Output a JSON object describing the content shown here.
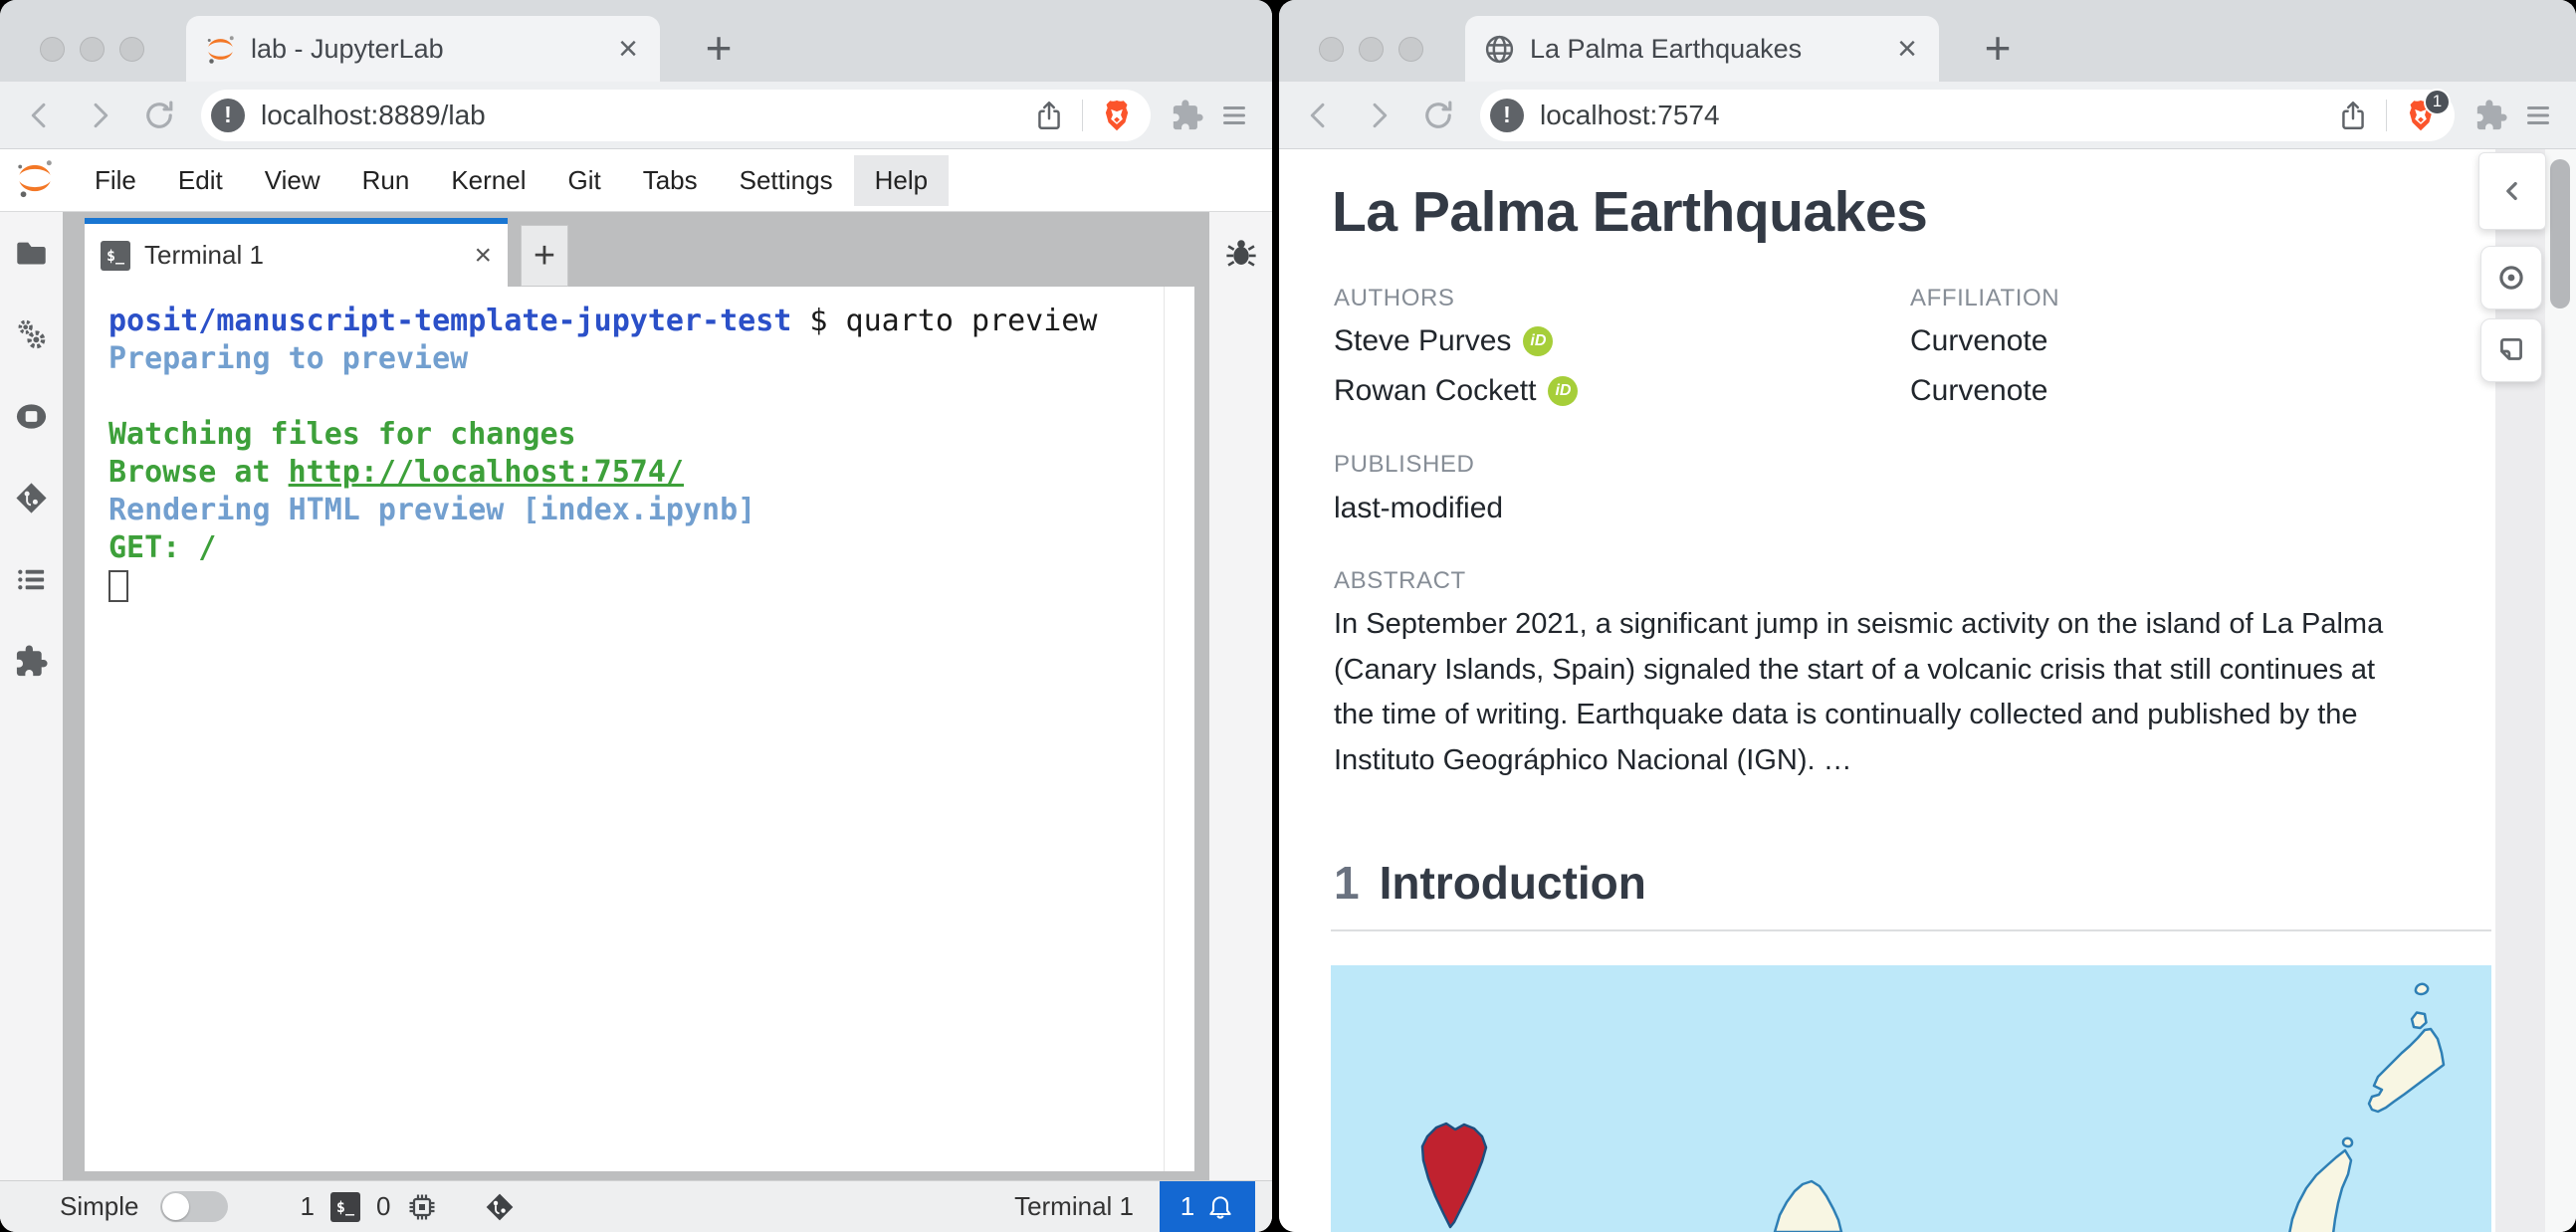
{
  "colors": {
    "accent_blue": "#1976d2",
    "notification_blue": "#1468d2",
    "orcid_green": "#a6ce39",
    "brave_orange": "#fb542b",
    "jupyter_orange": "#f37726",
    "terminal_blue": "#2b50c8",
    "terminal_lightblue": "#729fcf",
    "terminal_green": "#3da03a",
    "map_sea": "#bde8f9",
    "map_land": "#f8f6e3",
    "map_outline": "#2e7fb5",
    "map_highlight": "#c0222f"
  },
  "glyphs": {
    "close": "×",
    "new_tab": "+",
    "add_tab": "+",
    "terminal": "$_",
    "orcid": "iD",
    "info": "!"
  },
  "left_window": {
    "tab_title": "lab - JupyterLab",
    "url": "localhost:8889/lab",
    "menu": [
      "File",
      "Edit",
      "View",
      "Run",
      "Kernel",
      "Git",
      "Tabs",
      "Settings",
      "Help"
    ],
    "dock_tab": "Terminal 1",
    "terminal": {
      "lines": [
        {
          "segments": [
            {
              "text": "posit/manuscript-template-jupyter-test",
              "style": "path"
            },
            {
              "text": " $ quarto preview",
              "style": "plain"
            }
          ]
        },
        {
          "segments": [
            {
              "text": "Preparing to preview",
              "style": "info"
            }
          ]
        },
        {
          "segments": []
        },
        {
          "segments": [
            {
              "text": "Watching files for changes",
              "style": "ok"
            }
          ]
        },
        {
          "segments": [
            {
              "text": "Browse at ",
              "style": "ok"
            },
            {
              "text": "http://localhost:7574/",
              "style": "ok-link"
            }
          ]
        },
        {
          "segments": [
            {
              "text": "Rendering HTML preview [index.ipynb]",
              "style": "info"
            }
          ]
        },
        {
          "segments": [
            {
              "text": "GET: /",
              "style": "ok"
            }
          ]
        }
      ]
    },
    "status": {
      "mode_label": "Simple",
      "terminal_count": "1",
      "kernel_count": "0",
      "context": "Terminal 1",
      "notification_count": "1"
    }
  },
  "right_window": {
    "tab_title": "La Palma Earthquakes",
    "url": "localhost:7574",
    "shield_badge": "1",
    "page": {
      "title": "La Palma Earthquakes",
      "authors_label": "AUTHORS",
      "affiliation_label": "AFFILIATION",
      "authors": [
        {
          "name": "Steve Purves",
          "affiliation": "Curvenote"
        },
        {
          "name": "Rowan Cockett",
          "affiliation": "Curvenote"
        }
      ],
      "published_label": "PUBLISHED",
      "published": "last-modified",
      "abstract_label": "ABSTRACT",
      "abstract_lines": [
        "In September 2021, a significant jump in seismic activity on the island of La Palma",
        "(Canary Islands, Spain) signaled the start of a volcanic crisis that still continues at",
        "the time of writing. Earthquake data is continually collected and published by the",
        "Instituto Geográphico Nacional (IGN). …"
      ],
      "section_number": "1",
      "section_title": "Introduction"
    }
  }
}
